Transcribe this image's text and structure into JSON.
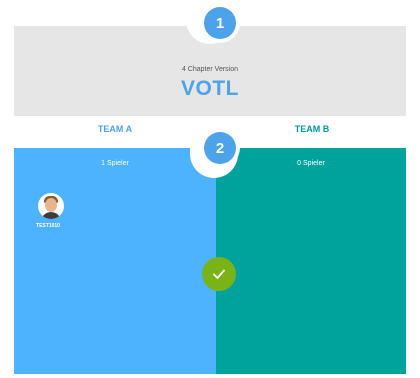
{
  "steps": {
    "one": "1",
    "two": "2"
  },
  "version": {
    "subtitle": "4 Chapter Version",
    "title": "VOTL"
  },
  "teams": {
    "a": {
      "title": "TEAM A",
      "count": "1 Spieler",
      "color": "#4db3ff",
      "players": [
        {
          "name": "TEST1010"
        }
      ]
    },
    "b": {
      "title": "TEAM B",
      "count": "0 Spieler",
      "color": "#00a39b"
    }
  },
  "icons": {
    "confirm": "checkmark-icon",
    "avatar": "player-avatar-icon"
  },
  "colors": {
    "accent": "#4da3ea",
    "confirm": "#7ab317",
    "panel": "#e6e6e6"
  }
}
